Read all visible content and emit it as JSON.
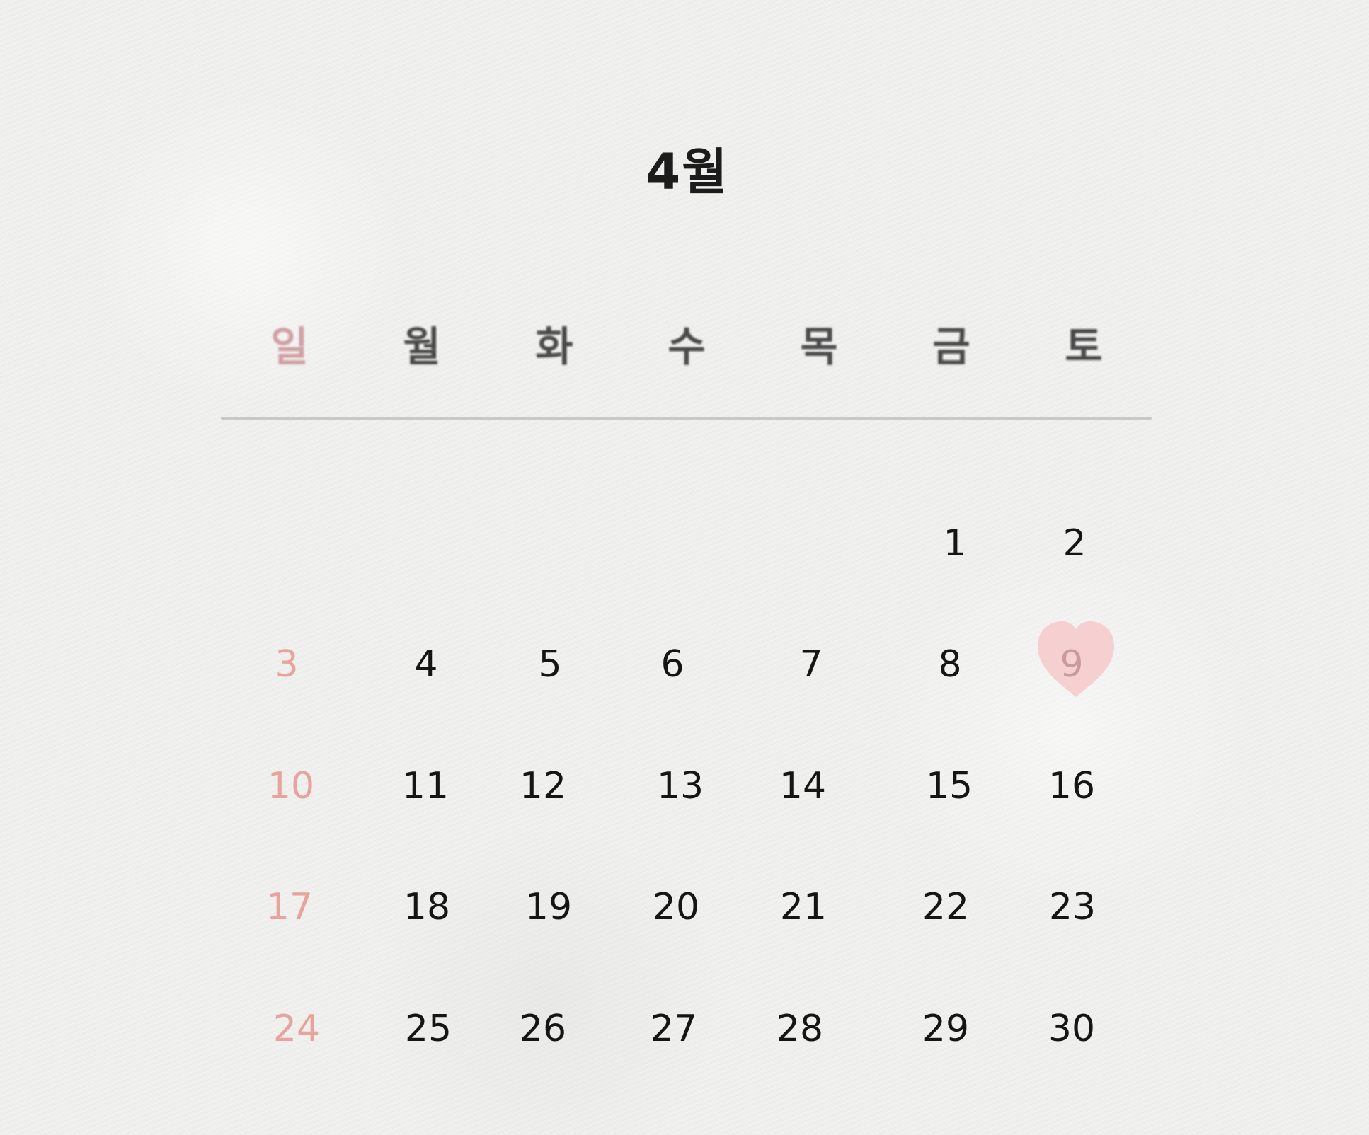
{
  "month_title": "4월",
  "weekdays": [
    "일",
    "월",
    "화",
    "수",
    "목",
    "금",
    "토"
  ],
  "weeks": [
    [
      "",
      "",
      "",
      "",
      "",
      "1",
      "2"
    ],
    [
      "3",
      "4",
      "5",
      "6",
      "7",
      "8",
      "9"
    ],
    [
      "10",
      "11",
      "12",
      "13",
      "14",
      "15",
      "16"
    ],
    [
      "17",
      "18",
      "19",
      "20",
      "21",
      "22",
      "23"
    ],
    [
      "24",
      "25",
      "26",
      "27",
      "28",
      "29",
      "30"
    ]
  ],
  "highlighted_day": "9",
  "colors": {
    "background": "#f1f1f0",
    "text": "#151515",
    "sunday": "#e8a39c",
    "heart": "#f6cfd1",
    "divider": "#c8c8c8"
  },
  "icons": {
    "highlight_marker": "heart-icon"
  }
}
